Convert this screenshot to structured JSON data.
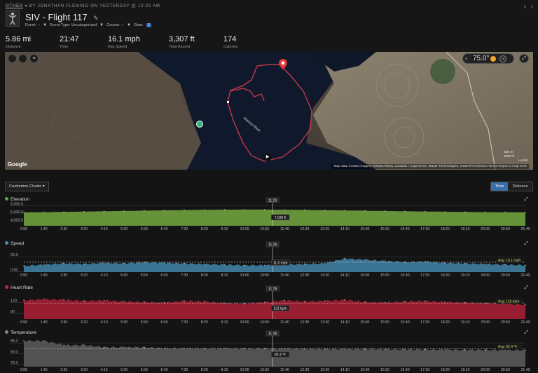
{
  "header": {
    "other_label": "OTHER",
    "byline": "BY JONATHAN FLEMING ON YESTERDAY @ 10:25 AM",
    "title": "SIV - Flight 117",
    "event_label": "Event: --",
    "event_type_label": "Event Type: Uncategorized",
    "course_label": "Course: --",
    "gear_label": "Gear:",
    "gear_count": "1",
    "prev_icon": "chevron-left-icon",
    "next_icon": "chevron-right-icon"
  },
  "stats": [
    {
      "value": "5.86 mi",
      "label": "Distance"
    },
    {
      "value": "21:47",
      "label": "Time"
    },
    {
      "value": "16.1 mph",
      "label": "Avg Speed"
    },
    {
      "value": "3,307 ft",
      "label": "Total Ascent"
    },
    {
      "value": "174",
      "label": "Calories"
    }
  ],
  "map": {
    "temperature": "75.0°",
    "time_scale_badge": "15",
    "river_label": "Mission River",
    "scale_m": "500 m",
    "scale_ft": "2000 ft",
    "leaflet": "Leaflet",
    "attribution": "Map data ©2025 Imagery ©2025 Airbus, Landsat / Copernicus, Maxar Technologies, USDA/FPAC/GEO   Terms   Report a map error",
    "google": "Google",
    "icons": [
      "layers-icon",
      "temperature-icon",
      "sun-icon",
      "expand-icon",
      "play-icon",
      "start-pin-icon",
      "end-pin-icon"
    ],
    "colors": {
      "track": "#c0384b",
      "water": "#10192b",
      "start": "#2bb673",
      "end": "#e23a3a"
    }
  },
  "controls": {
    "customize_label": "Customize Charts",
    "time_label": "Time",
    "distance_label": "Distance"
  },
  "time_ticks": [
    "0:50",
    "1:40",
    "2:30",
    "3:20",
    "4:10",
    "5:00",
    "5:50",
    "6:40",
    "7:30",
    "8:20",
    "9:10",
    "10:00",
    "10:50",
    "11:40",
    "12:30",
    "13:20",
    "14:10",
    "15:00",
    "15:50",
    "16:40",
    "17:30",
    "18:20",
    "19:10",
    "20:00",
    "20:50",
    "21:40"
  ],
  "cursor_time": "11:29",
  "charts": [
    {
      "key": "elevation",
      "title": "Elevation",
      "color": "#6a9a3c",
      "dot": "#5ea53a",
      "y_ticks": [
        "8,000.0",
        "6,000.0",
        "4,000.0"
      ],
      "ylim": [
        3000,
        8600
      ],
      "cursor_value": "7,039 ft",
      "avg_label": "",
      "values": [
        6320,
        6380,
        6460,
        6540,
        6620,
        6700,
        6780,
        6850,
        6920,
        6980,
        7020,
        7040,
        7039,
        7000,
        6950,
        6890,
        6830,
        6760,
        6690,
        6620,
        6560,
        6500,
        6440,
        6400,
        6370,
        6350
      ]
    },
    {
      "key": "speed",
      "title": "Speed",
      "color": "#3d7899",
      "dot": "#4a8bb5",
      "y_ticks": [
        "25.0",
        "0.50"
      ],
      "ylim": [
        0,
        40
      ],
      "cursor_value": "11.0 mph",
      "avg_label": "Avg: 16.1 mph",
      "avg": 16.1,
      "values": [
        10,
        12,
        14,
        13,
        15,
        14,
        16,
        15,
        14,
        13,
        12,
        11,
        11,
        12,
        13,
        14,
        22,
        20,
        18,
        16,
        17,
        15,
        14,
        13,
        12,
        11
      ]
    },
    {
      "key": "heart_rate",
      "title": "Heart Rate",
      "color": "#9e1f33",
      "dot": "#c7283f",
      "y_ticks": [
        "120",
        "80"
      ],
      "ylim": [
        60,
        160
      ],
      "cursor_value": "121 bpm",
      "avg_label": "Avg: 118 bpm",
      "avg": 118,
      "values": [
        128,
        132,
        130,
        126,
        128,
        124,
        122,
        120,
        126,
        124,
        118,
        116,
        121,
        128,
        124,
        126,
        130,
        122,
        120,
        124,
        126,
        122,
        120,
        118,
        116,
        112
      ]
    },
    {
      "key": "temperature",
      "title": "Temperature",
      "color": "#555555",
      "dot": "#888888",
      "y_ticks": [
        "85.0",
        "80.0",
        "75.0"
      ],
      "ylim": [
        74,
        88
      ],
      "cursor_value": "82.4 °F",
      "avg_label": "Avg: 82.4 °F",
      "avg": 82.4,
      "values": [
        86,
        86,
        84,
        84,
        83,
        83,
        83,
        82.5,
        82.5,
        82.4,
        82.4,
        82.4,
        82.4,
        82.4,
        82.3,
        82.2,
        82.2,
        82.2,
        82.1,
        82,
        82,
        81.9,
        81.8,
        81.8,
        81.7,
        81.7
      ]
    }
  ]
}
